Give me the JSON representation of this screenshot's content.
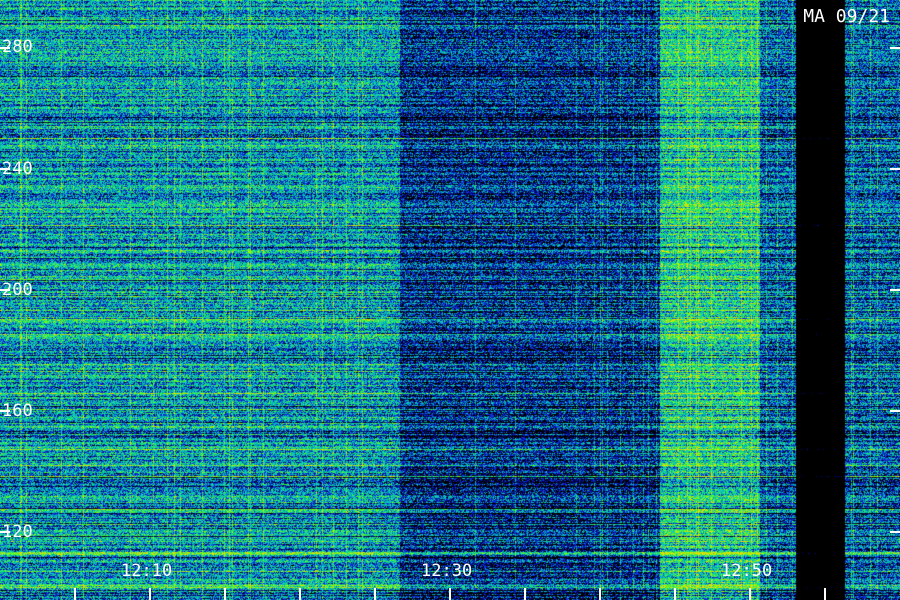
{
  "title": "MA 09/21",
  "y_labels": [
    "280",
    "240",
    "200",
    "160",
    "120"
  ],
  "x_labels": [
    "12:10",
    "12:30",
    "12:50"
  ],
  "palette": {
    "background": "#000000",
    "deep_blue": "#000c8c",
    "blue": "#1030d8",
    "teal": "#00a0b4",
    "cyan": "#10c8c0",
    "green": "#20e070",
    "bright_green": "#60ff20",
    "yellow": "#e0e000",
    "label": "#ffffff"
  }
}
